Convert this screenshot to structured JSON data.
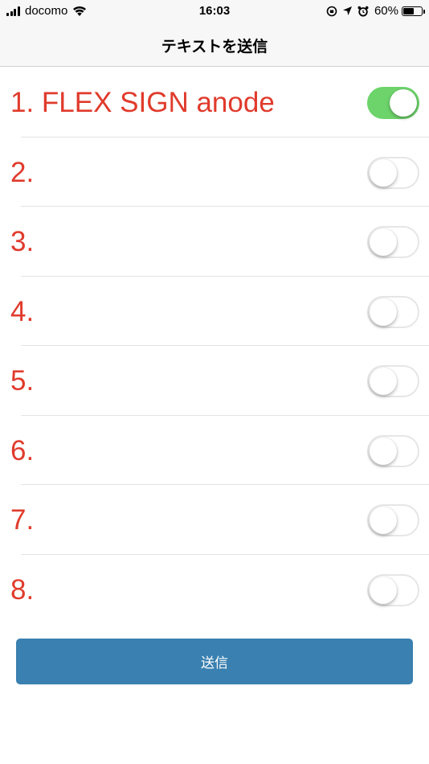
{
  "status_bar": {
    "carrier": "docomo",
    "time": "16:03",
    "battery_percent": "60%",
    "battery_level": 0.6
  },
  "nav": {
    "title": "テキストを送信"
  },
  "items": [
    {
      "label": "1. FLEX SIGN anode",
      "enabled": true
    },
    {
      "label": "2.",
      "enabled": false
    },
    {
      "label": "3.",
      "enabled": false
    },
    {
      "label": "4.",
      "enabled": false
    },
    {
      "label": "5.",
      "enabled": false
    },
    {
      "label": "6.",
      "enabled": false
    },
    {
      "label": "7.",
      "enabled": false
    },
    {
      "label": "8.",
      "enabled": false
    }
  ],
  "send_button": {
    "label": "送信"
  },
  "colors": {
    "label_red": "#e03b2c",
    "toggle_on": "#6dd36b",
    "button_blue": "#3a80b0"
  }
}
